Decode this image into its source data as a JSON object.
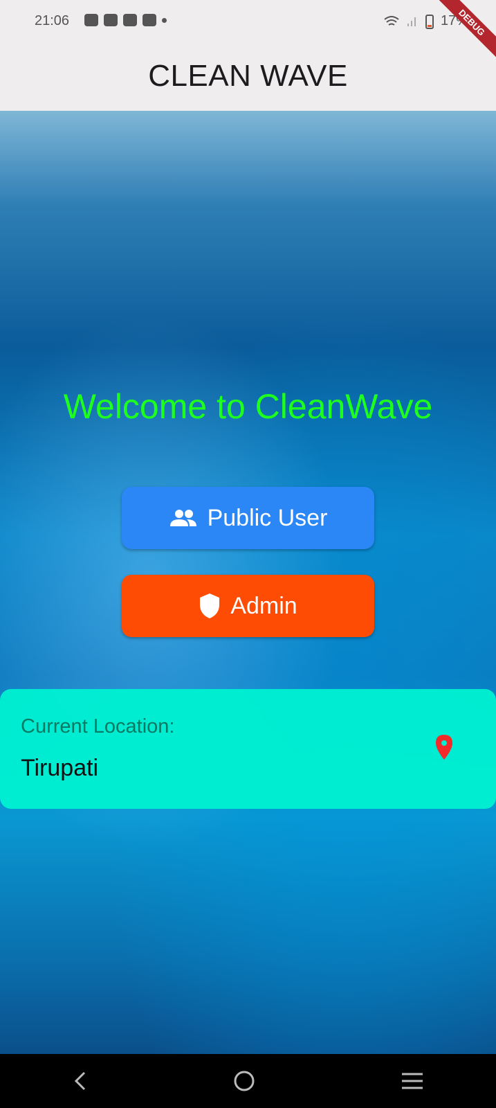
{
  "status_bar": {
    "time": "21:06",
    "battery": "17%"
  },
  "debug_banner": "DEBUG",
  "app_bar": {
    "title": "CLEAN WAVE"
  },
  "main": {
    "welcome": "Welcome to CleanWave",
    "public_user_label": "Public User",
    "admin_label": "Admin",
    "public_user_color": "#2b86f6",
    "admin_color": "#ff4c05"
  },
  "location_card": {
    "label": "Current Location:",
    "value": "Tirupati",
    "icon": "location-pin-icon"
  },
  "nav_bar": {
    "icons": [
      "back-icon",
      "home-icon",
      "menu-icon"
    ]
  }
}
